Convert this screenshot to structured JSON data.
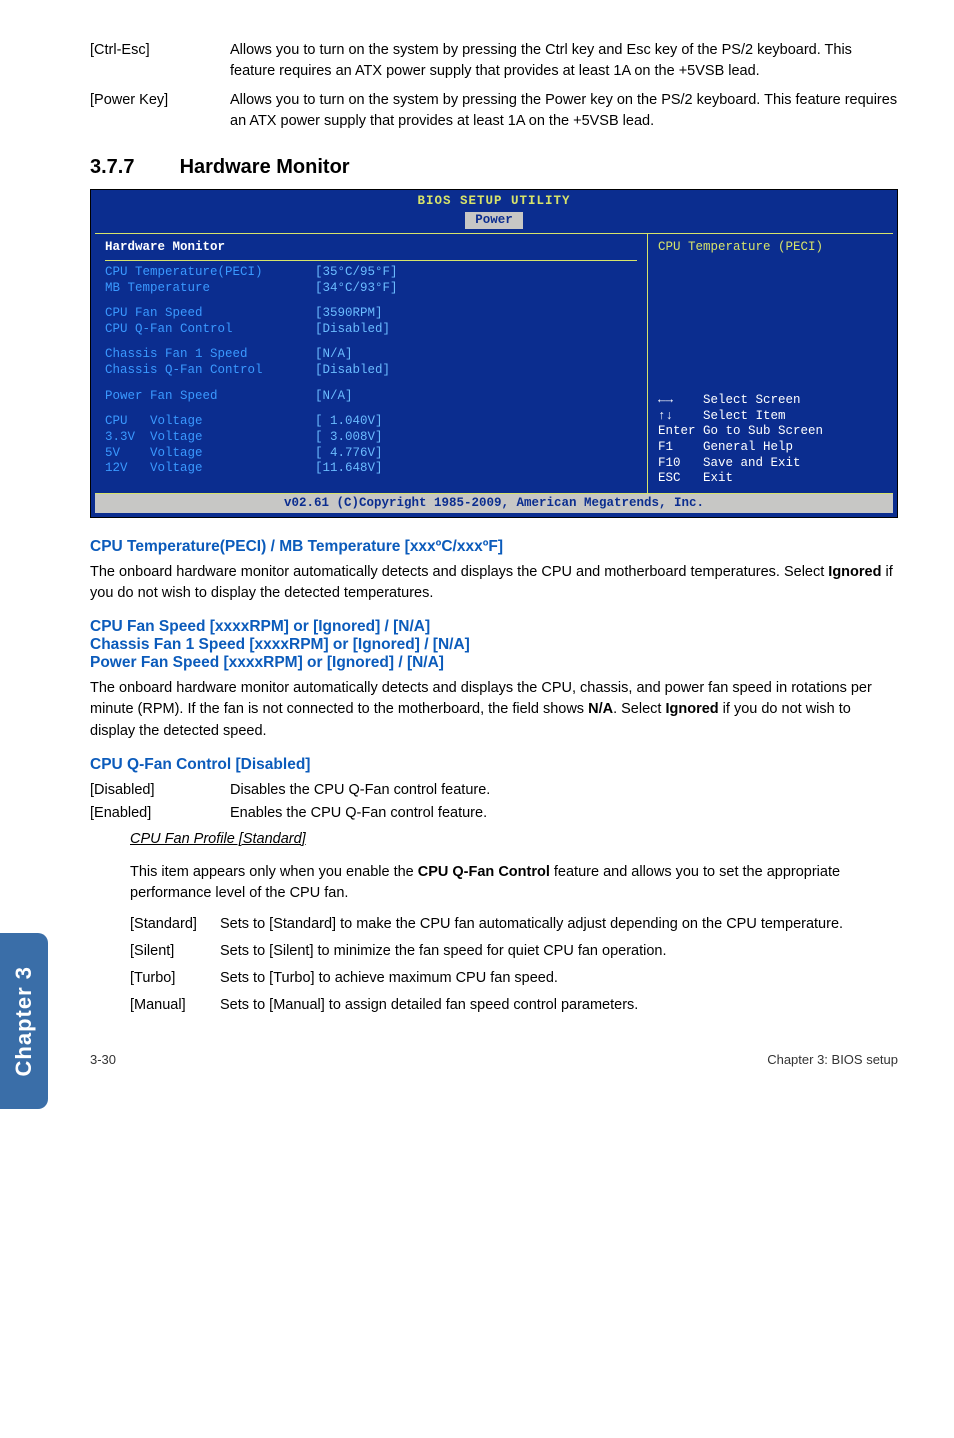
{
  "top_defs": [
    {
      "term": "[Ctrl-Esc]",
      "desc": "Allows you to turn on the system by pressing the Ctrl key and Esc key of the PS/2 keyboard. This feature requires an ATX power supply that provides at least 1A on the +5VSB lead."
    },
    {
      "term": "[Power Key]",
      "desc": "Allows you to turn on the system by pressing the Power key on the PS/2 keyboard. This feature requires an ATX power supply that provides at least 1A on the +5VSB lead."
    }
  ],
  "section_number": "3.7.7",
  "section_title": "Hardware Monitor",
  "bios": {
    "header": "BIOS SETUP UTILITY",
    "tab": "Power",
    "left_title": "Hardware Monitor",
    "right_title": "CPU Temperature (PECI)",
    "rows1": [
      {
        "k": "CPU Temperature(PECI)",
        "v": "[35°C/95°F]"
      },
      {
        "k": "MB Temperature",
        "v": "[34°C/93°F]"
      }
    ],
    "rows2": [
      {
        "k": "CPU Fan Speed",
        "v": "[3590RPM]"
      },
      {
        "k": "CPU Q-Fan Control",
        "v": "[Disabled]"
      }
    ],
    "rows3": [
      {
        "k": "Chassis Fan 1 Speed",
        "v": "[N/A]"
      },
      {
        "k": "Chassis Q-Fan Control",
        "v": "[Disabled]"
      }
    ],
    "rows4": [
      {
        "k": "Power Fan Speed",
        "v": "[N/A]"
      }
    ],
    "rows5": [
      {
        "k": "CPU   Voltage",
        "v": "[ 1.040V]"
      },
      {
        "k": "3.3V  Voltage",
        "v": "[ 3.008V]"
      },
      {
        "k": "5V    Voltage",
        "v": "[ 4.776V]"
      },
      {
        "k": "12V   Voltage",
        "v": "[11.648V]"
      }
    ],
    "nav": [
      "←→    Select Screen",
      "↑↓    Select Item",
      "Enter Go to Sub Screen",
      "F1    General Help",
      "F10   Save and Exit",
      "ESC   Exit"
    ],
    "footer": "v02.61 (C)Copyright 1985-2009, American Megatrends, Inc."
  },
  "sub1": {
    "head": "CPU Temperature(PECI) / MB Temperature [xxxºC/xxxºF]",
    "body_pre": "The onboard hardware monitor automatically detects and displays the CPU and motherboard temperatures. Select ",
    "body_bold": "Ignored",
    "body_post": " if you do not wish to display the detected temperatures."
  },
  "sub2": {
    "head1": "CPU Fan Speed [xxxxRPM] or [Ignored] / [N/A]",
    "head2": "Chassis Fan 1 Speed [xxxxRPM] or [Ignored] / [N/A]",
    "head3": "Power Fan Speed [xxxxRPM] or [Ignored] / [N/A]",
    "body_pre": "The onboard hardware monitor automatically detects and displays the CPU, chassis, and power fan speed in rotations per minute (RPM). If the fan is not connected to the motherboard, the field shows ",
    "body_bold1": "N/A",
    "body_mid": ". Select ",
    "body_bold2": "Ignored",
    "body_post": " if you do not wish to display the detected speed."
  },
  "sub3": {
    "head": "CPU Q-Fan Control [Disabled]",
    "defs": [
      {
        "t": "[Disabled]",
        "d": "Disables the CPU Q-Fan control feature."
      },
      {
        "t": "[Enabled]",
        "d": "Enables the CPU Q-Fan control feature."
      }
    ],
    "profile_head": "CPU Fan Profile [Standard]",
    "profile_body_pre": "This item appears only when you enable the ",
    "profile_body_bold": "CPU Q-Fan Control",
    "profile_body_post": " feature and allows you to set the appropriate performance level of the CPU fan.",
    "opts": [
      {
        "t": "[Standard]",
        "d": "Sets to [Standard] to make the CPU fan automatically adjust depending on the CPU temperature."
      },
      {
        "t": "[Silent]",
        "d": "Sets to [Silent] to minimize the fan speed for quiet CPU fan operation."
      },
      {
        "t": "[Turbo]",
        "d": "Sets to [Turbo] to achieve maximum CPU fan speed."
      },
      {
        "t": "[Manual]",
        "d": "Sets to [Manual] to assign detailed fan speed control parameters."
      }
    ]
  },
  "side_tab": "Chapter 3",
  "footer_left": "3-30",
  "footer_right": "Chapter 3: BIOS setup"
}
